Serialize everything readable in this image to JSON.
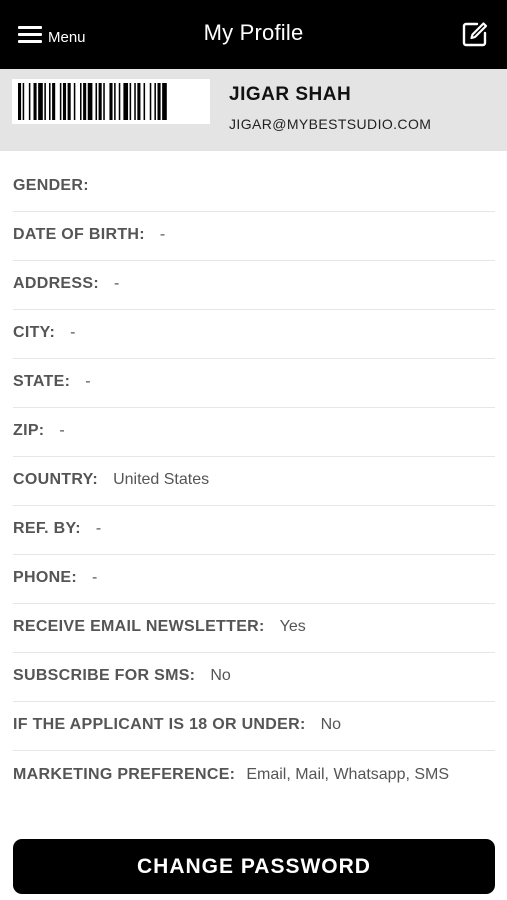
{
  "header": {
    "menu_label": "Menu",
    "title": "My Profile",
    "icons": {
      "menu": "hamburger-icon",
      "edit": "edit-icon"
    }
  },
  "profile": {
    "name": "JIGAR SHAH",
    "email": "JIGAR@MYBESTSUDIO.COM"
  },
  "fields": [
    {
      "label": "GENDER:",
      "value": ""
    },
    {
      "label": "DATE OF BIRTH:",
      "value": "-"
    },
    {
      "label": "ADDRESS:",
      "value": "-"
    },
    {
      "label": "CITY:",
      "value": "-"
    },
    {
      "label": "STATE:",
      "value": "-"
    },
    {
      "label": "ZIP:",
      "value": "-"
    },
    {
      "label": "COUNTRY:",
      "value": "United States"
    },
    {
      "label": "REF. BY:",
      "value": "-"
    },
    {
      "label": "PHONE:",
      "value": "-"
    },
    {
      "label": "RECEIVE EMAIL NEWSLETTER:",
      "value": "Yes"
    },
    {
      "label": "SUBSCRIBE FOR SMS:",
      "value": "No"
    },
    {
      "label": "IF THE APPLICANT IS 18 OR UNDER:",
      "value": "No"
    },
    {
      "label": "MARKETING PREFERENCE:",
      "value": "Email, Mail, Whatsapp, SMS"
    }
  ],
  "actions": {
    "change_password": "CHANGE PASSWORD"
  },
  "colors": {
    "header_bg": "#000000",
    "card_bg": "#e4e4e4",
    "label": "#555555",
    "button_bg": "#000000"
  }
}
